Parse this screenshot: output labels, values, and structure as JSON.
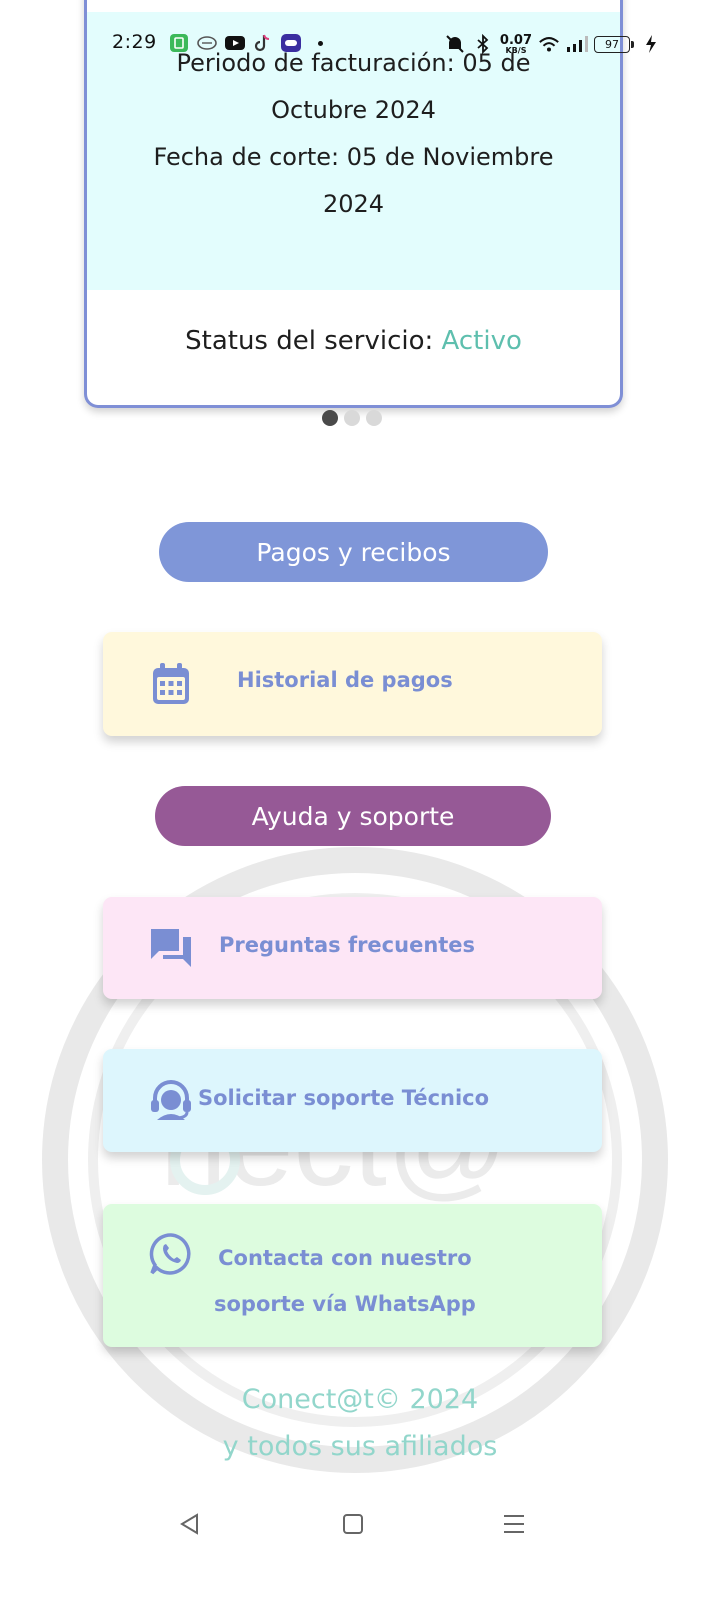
{
  "status_bar": {
    "time": "2:29",
    "net_speed": "0.07",
    "net_unit": "KB/S",
    "battery": "97",
    "icons_left": [
      "app-store-icon",
      "messaging-app-icon",
      "youtube-icon",
      "tiktok-icon",
      "game-app-icon"
    ],
    "icons_right": [
      "mute-icon",
      "bluetooth-icon",
      "wifi-icon",
      "signal-icon",
      "battery-icon",
      "charging-icon"
    ]
  },
  "billing_card": {
    "period_line1": "Periodo de facturación: 05 de",
    "period_line2": "Octubre 2024",
    "cutoff_line1": "Fecha de corte: 05 de Noviembre",
    "cutoff_line2": "2024",
    "status_label": "Status del servicio:",
    "status_value": "Activo"
  },
  "carousel": {
    "pages": 3,
    "active_index": 0
  },
  "sections": {
    "pagos_title": "Pagos y recibos",
    "ayuda_title": "Ayuda y soporte"
  },
  "options": {
    "historial": "Historial de pagos",
    "preguntas": "Preguntas frecuentes",
    "soporte": "Solicitar soporte Técnico",
    "whatsapp_line1": "Contacta con nuestro",
    "whatsapp_line2": "soporte vía WhatsApp"
  },
  "footer": {
    "line1": "Conect@t© 2024",
    "line2": "y todos sus afiliados"
  },
  "watermark": {
    "text": "Conect@t"
  },
  "colors": {
    "card_border": "#7f8fd6",
    "card_top_bg": "#e3fdfd",
    "status_active": "#5ebfae",
    "pagos_header": "#7f96d8",
    "ayuda_header": "#965996",
    "option_text": "#7a8ed3",
    "historial_bg": "#fff8dc",
    "preguntas_bg": "#fde6f6",
    "soporte_bg": "#ddf6fd",
    "whatsapp_bg": "#ddfcdf",
    "footer_text": "#92d6cb"
  }
}
